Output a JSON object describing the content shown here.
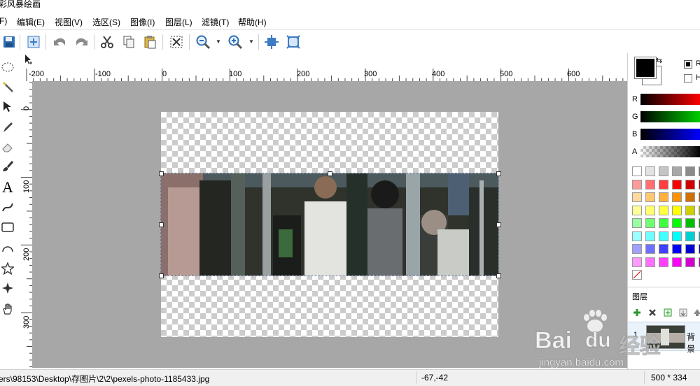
{
  "window": {
    "title": "彩风暴绘画",
    "minimize_glyph": "—"
  },
  "menu": [
    {
      "label": "F)"
    },
    {
      "label": "编辑(E)"
    },
    {
      "label": "视图(V)"
    },
    {
      "label": "选区(S)"
    },
    {
      "label": "图像(I)"
    },
    {
      "label": "图层(L)"
    },
    {
      "label": "滤镜(T)"
    },
    {
      "label": "帮助(H)"
    }
  ],
  "toolbar": {
    "icons": [
      "save-icon",
      "new-layer-icon",
      "undo-icon",
      "redo-icon",
      "cut-icon",
      "copy-icon",
      "paste-icon",
      "crop-select-icon",
      "zoom-out-icon",
      "zoom-in-icon",
      "fit-window-icon",
      "actual-size-icon"
    ]
  },
  "tools": [
    "ellipse-select-icon",
    "magic-wand-icon",
    "move-selection-icon",
    "pencil-icon",
    "eraser-icon",
    "brush-icon",
    "text-icon",
    "curve-icon",
    "rectangle-icon",
    "ellipse-icon",
    "star-icon",
    "sparkle-icon",
    "hand-icon"
  ],
  "rulers": {
    "horizontal_labels": [
      "-200",
      "-100",
      "0",
      "100",
      "200",
      "300",
      "400",
      "500",
      "600"
    ],
    "vertical_labels": [
      "0",
      "100",
      "200",
      "300"
    ]
  },
  "status": {
    "path": "ers\\98153\\Desktop\\存图片\\2\\2\\pexels-photo-1185433.jpg",
    "coords": "-67,-42",
    "size": "500 * 334"
  },
  "colors": {
    "primary": "#000000",
    "secondary": "#ffffff",
    "canvas_bg": "#a7a7a7",
    "selection": "#6a7fa0"
  },
  "color_panel": {
    "mode_r": "R",
    "mode_h": "H",
    "slider_labels": [
      "R",
      "G",
      "B",
      "A"
    ],
    "palette": [
      [
        "#ffffff",
        "#e2e2e2",
        "#c5c5c5",
        "#a8a8a8",
        "#8b8b8b",
        "#6e6e6e"
      ],
      [
        "#ff9a9a",
        "#ff7070",
        "#ff4040",
        "#ff0000",
        "#d00000",
        "#a00000"
      ],
      [
        "#ffd9a0",
        "#ffc870",
        "#ffb040",
        "#ff9000",
        "#d07000",
        "#a05000"
      ],
      [
        "#ffff9a",
        "#ffff70",
        "#ffff40",
        "#ffff00",
        "#d0d000",
        "#a0a000"
      ],
      [
        "#9affa0",
        "#70ff70",
        "#40ff40",
        "#00ff00",
        "#00c000",
        "#009000"
      ],
      [
        "#9affff",
        "#70ffff",
        "#40ffff",
        "#00ffff",
        "#00d0d0",
        "#00a0a0"
      ],
      [
        "#a0a0ff",
        "#7070ff",
        "#4040ff",
        "#0000ff",
        "#0000d0",
        "#0000a0"
      ],
      [
        "#ff9aff",
        "#ff70ff",
        "#ff40ff",
        "#ff00ff",
        "#d000d0",
        "#a000a0"
      ]
    ]
  },
  "layers": {
    "title": "图层",
    "buttons": [
      "add-layer-icon",
      "delete-layer-icon",
      "duplicate-layer-icon",
      "merge-down-icon",
      "move-up-icon"
    ],
    "items": [
      {
        "name": "背景",
        "visible_glyph": "1"
      }
    ]
  },
  "watermark": {
    "brand": "Bai",
    "du_mark": "du",
    "suffix": "经验",
    "url": "jingyan.baidu.com"
  }
}
